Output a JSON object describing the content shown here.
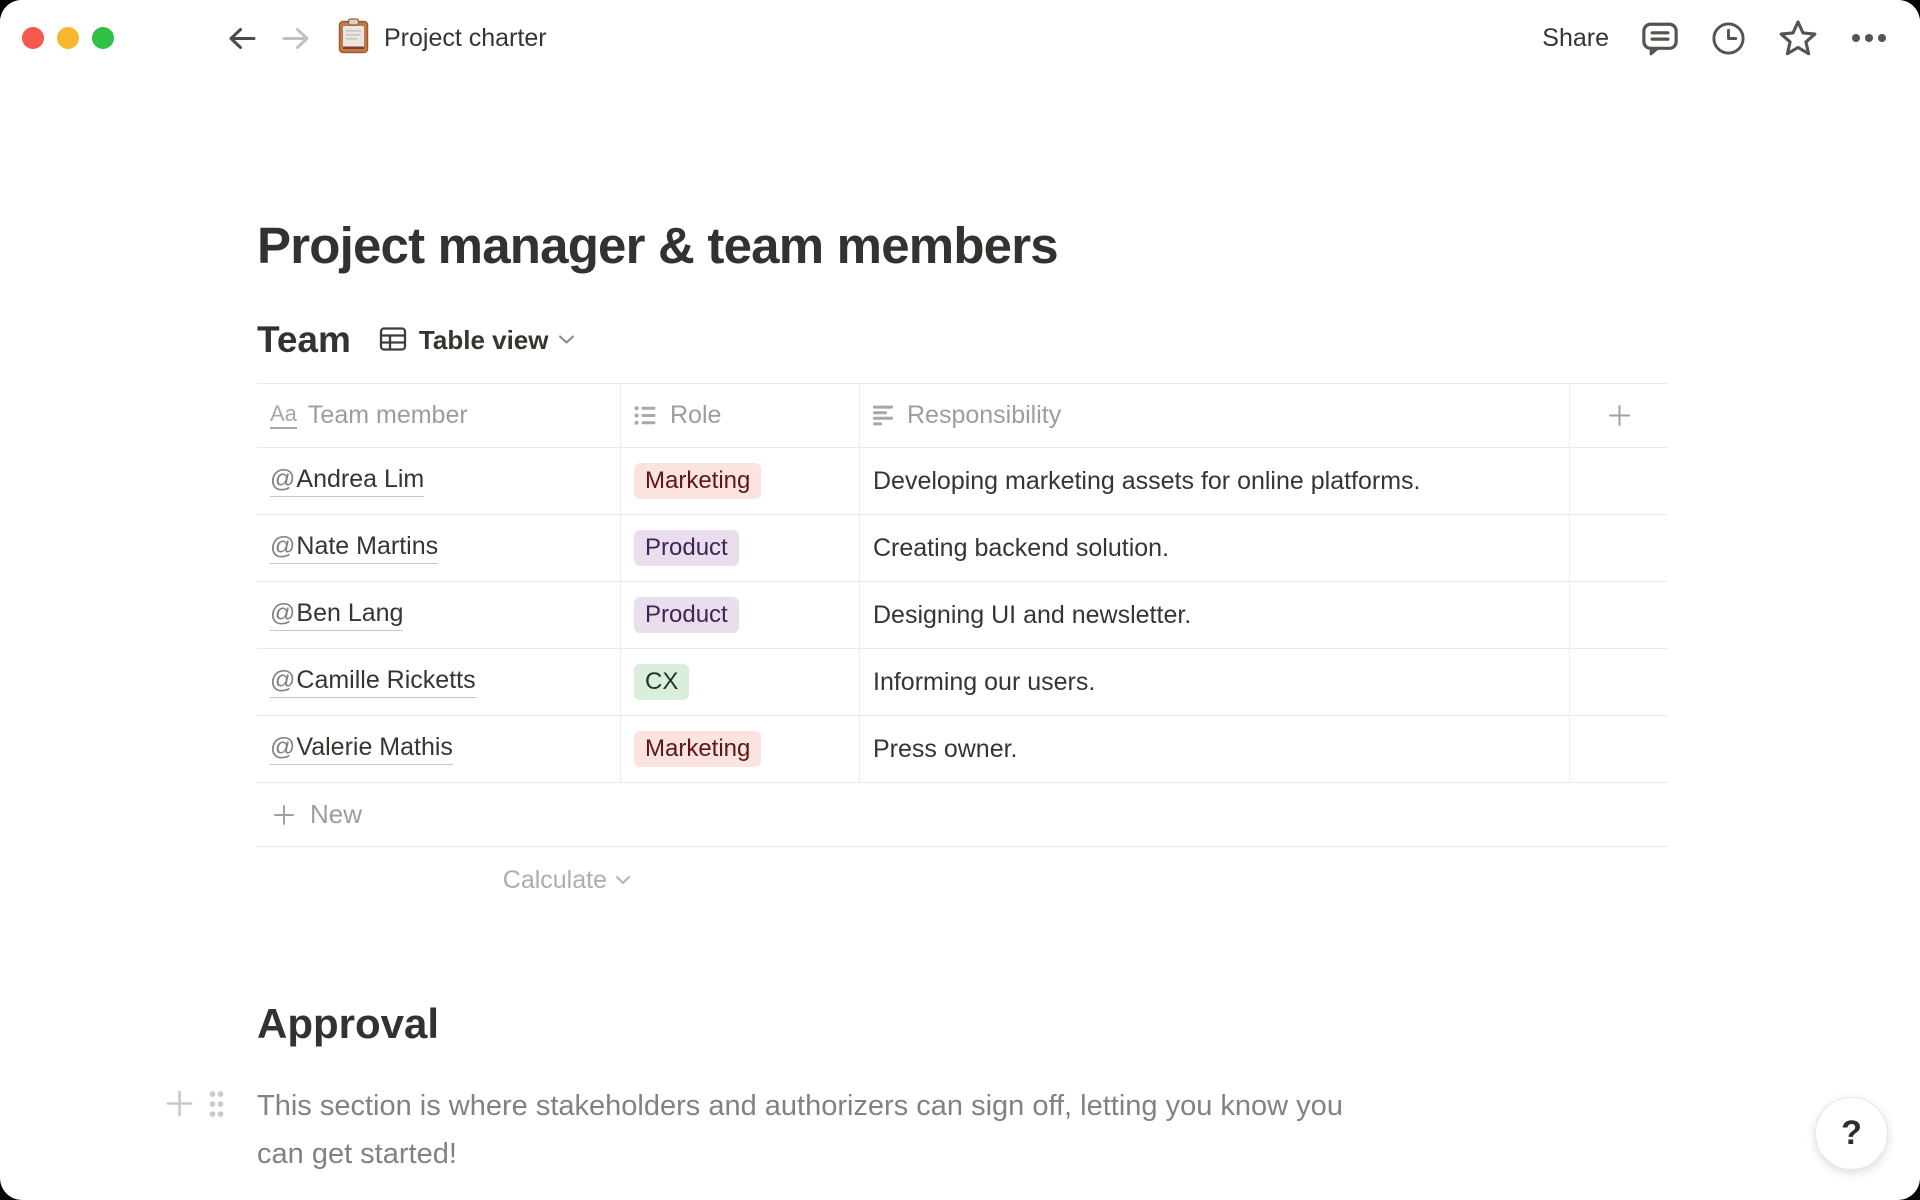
{
  "titlebar": {
    "doc_title": "Project charter",
    "share_label": "Share"
  },
  "page": {
    "title": "Project manager & team members",
    "approval_heading": "Approval",
    "approval_paragraph": "This section is where stakeholders and authorizers can sign off, letting you know you can get started!",
    "help_label": "?"
  },
  "team": {
    "heading": "Team",
    "view_label": "Table view",
    "columns": [
      {
        "label": "Team member",
        "icon": "title-icon",
        "glyph": "Aa"
      },
      {
        "label": "Role",
        "icon": "select-icon"
      },
      {
        "label": "Responsibility",
        "icon": "text-icon"
      }
    ],
    "rows": [
      {
        "at": "@",
        "name": "Andrea Lim",
        "role": "Marketing",
        "role_color": "red",
        "responsibility": "Developing marketing assets for online platforms."
      },
      {
        "at": "@",
        "name": "Nate Martins",
        "role": "Product",
        "role_color": "purple",
        "responsibility": "Creating backend solution."
      },
      {
        "at": "@",
        "name": "Ben Lang",
        "role": "Product",
        "role_color": "purple",
        "responsibility": "Designing UI and newsletter."
      },
      {
        "at": "@",
        "name": "Camille Ricketts",
        "role": "CX",
        "role_color": "green",
        "responsibility": "Informing our users."
      },
      {
        "at": "@",
        "name": "Valerie Mathis",
        "role": "Marketing",
        "role_color": "red",
        "responsibility": "Press owner."
      }
    ],
    "new_label": "New",
    "calculate_label": "Calculate"
  },
  "colors": {
    "tag_red_bg": "#fbe3e0",
    "tag_red_text": "#5d1715",
    "tag_purple_bg": "#e8deee",
    "tag_purple_text": "#412454",
    "tag_green_bg": "#dbeddb",
    "tag_green_text": "#1c3829",
    "traffic_red": "#f4584f",
    "traffic_yellow": "#f6b62d",
    "traffic_green": "#2ec146",
    "text_dark": "#37352f",
    "text_gray": "#9e9d99"
  }
}
